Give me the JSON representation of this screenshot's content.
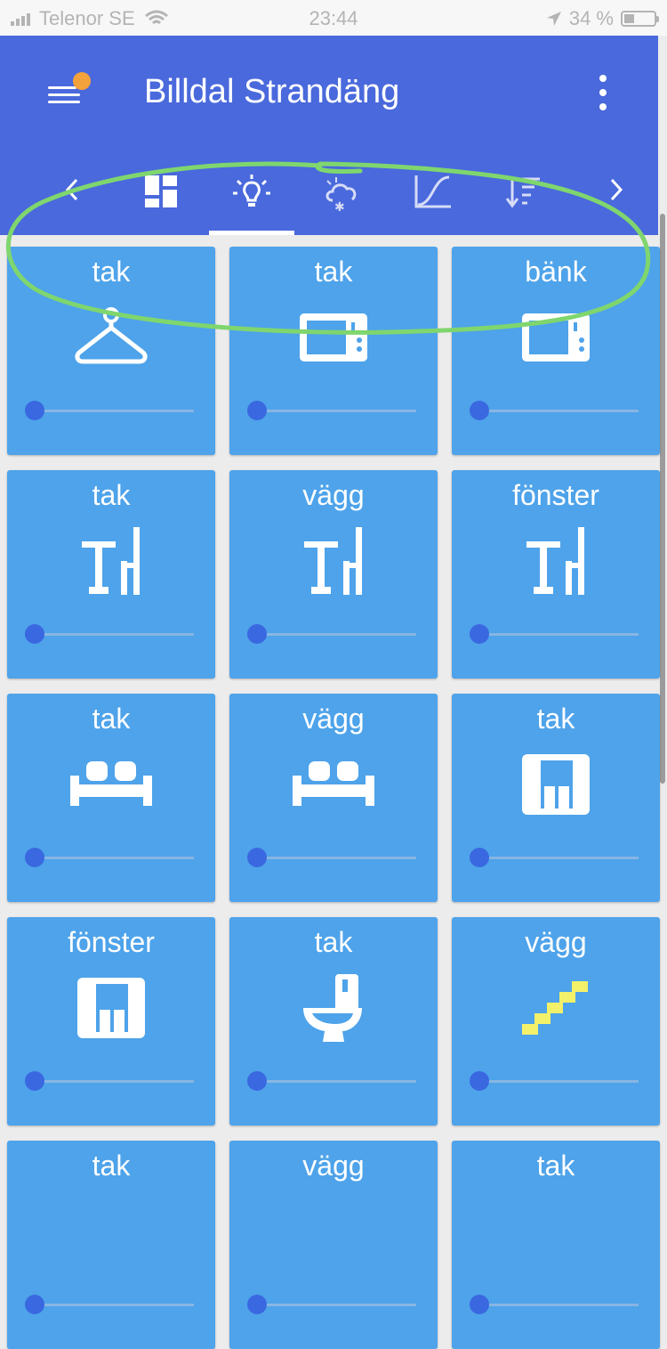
{
  "status": {
    "carrier": "Telenor SE",
    "time": "23:44",
    "battery": "34 %",
    "battery_fraction": 0.34
  },
  "app": {
    "title": "Billdal Strandäng",
    "accent": "#4a69dc",
    "tile_color": "#4ea3ea",
    "badge_color": "#f4a23c"
  },
  "tabs": [
    {
      "icon": "dashboard-icon",
      "active": false
    },
    {
      "icon": "lightbulb-icon",
      "active": true
    },
    {
      "icon": "weather-snow-icon",
      "active": false
    },
    {
      "icon": "curve-chart-icon",
      "active": false
    },
    {
      "icon": "sort-icon",
      "active": false
    }
  ],
  "tiles": [
    {
      "label": "tak",
      "icon": "hanger-icon",
      "level": 0
    },
    {
      "label": "tak",
      "icon": "microwave-icon",
      "level": 0
    },
    {
      "label": "bänk",
      "icon": "microwave-icon",
      "level": 0
    },
    {
      "label": "tak",
      "icon": "table-chair-icon",
      "level": 0
    },
    {
      "label": "vägg",
      "icon": "table-chair-icon",
      "level": 0
    },
    {
      "label": "fönster",
      "icon": "table-chair-icon",
      "level": 0
    },
    {
      "label": "tak",
      "icon": "sofa-icon",
      "level": 0
    },
    {
      "label": "vägg",
      "icon": "sofa-icon",
      "level": 0
    },
    {
      "label": "tak",
      "icon": "piano-icon",
      "level": 0
    },
    {
      "label": "fönster",
      "icon": "piano-icon",
      "level": 0
    },
    {
      "label": "tak",
      "icon": "toilet-icon",
      "level": 0
    },
    {
      "label": "vägg",
      "icon": "stairs-icon",
      "level": 0
    },
    {
      "label": "tak",
      "icon": "",
      "level": 0
    },
    {
      "label": "vägg",
      "icon": "",
      "level": 0
    },
    {
      "label": "tak",
      "icon": "",
      "level": 0
    }
  ]
}
